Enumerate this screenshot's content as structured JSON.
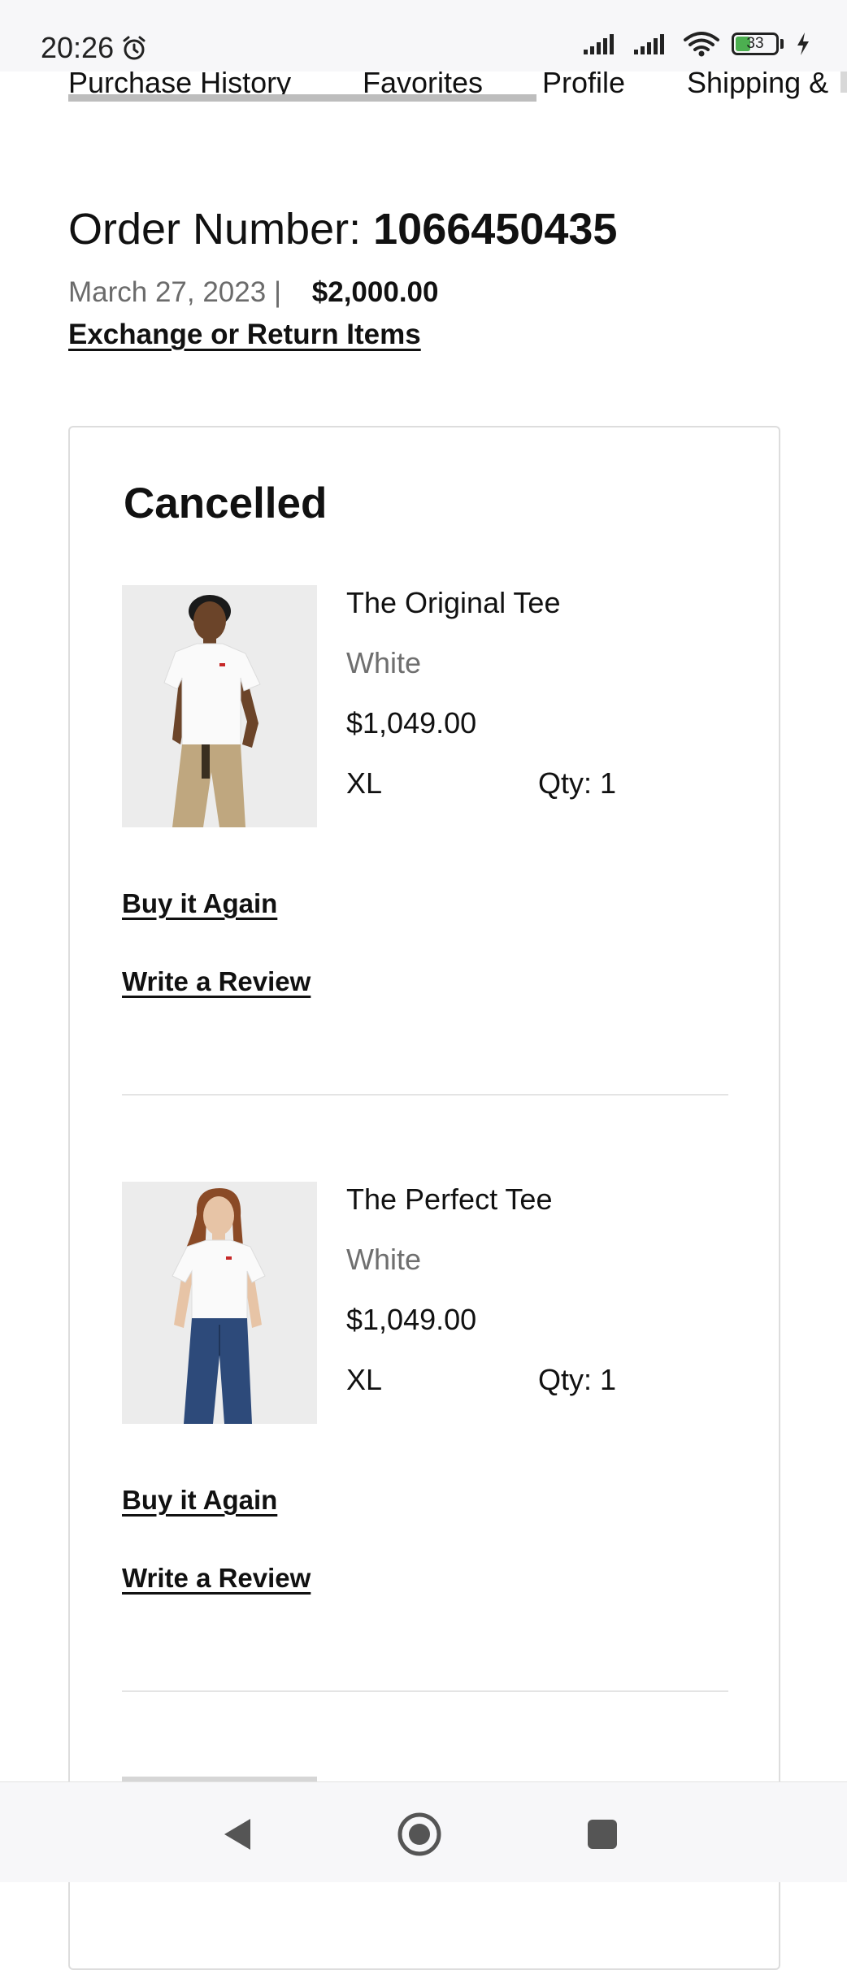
{
  "status_bar": {
    "time": "20:26",
    "battery_level": "33",
    "icons": [
      "alarm-icon",
      "signal-icon",
      "signal-icon",
      "wifi-icon",
      "battery-icon",
      "charging-icon"
    ]
  },
  "tabs": [
    {
      "label": "Purchase History"
    },
    {
      "label": "Favorites"
    },
    {
      "label": "Profile"
    },
    {
      "label": "Shipping &"
    }
  ],
  "order": {
    "number_label": "Order Number:",
    "number": "1066450435",
    "date": "March 27, 2023",
    "separator": "|",
    "total": "$2,000.00",
    "exchange_link": "Exchange or Return Items"
  },
  "card": {
    "status": "Cancelled",
    "items": [
      {
        "name": "The Original Tee",
        "color": "White",
        "price": "$1,049.00",
        "size": "XL",
        "qty": "Qty: 1",
        "buy_again": "Buy it Again",
        "review": "Write a Review",
        "image_icon": "product-photo-original-tee"
      },
      {
        "name": "The Perfect Tee",
        "color": "White",
        "price": "$1,049.00",
        "size": "XL",
        "qty": "Qty: 1",
        "buy_again": "Buy it Again",
        "review": "Write a Review",
        "image_icon": "product-photo-perfect-tee"
      }
    ]
  },
  "nav_bar": {
    "buttons": [
      "back-icon",
      "home-icon",
      "recents-icon"
    ]
  },
  "colors": {
    "text": "#111111",
    "muted": "#6b6b6b",
    "border": "#dddddd",
    "battery_fill": "#4caf50",
    "system_bar": "#f7f7f9"
  }
}
